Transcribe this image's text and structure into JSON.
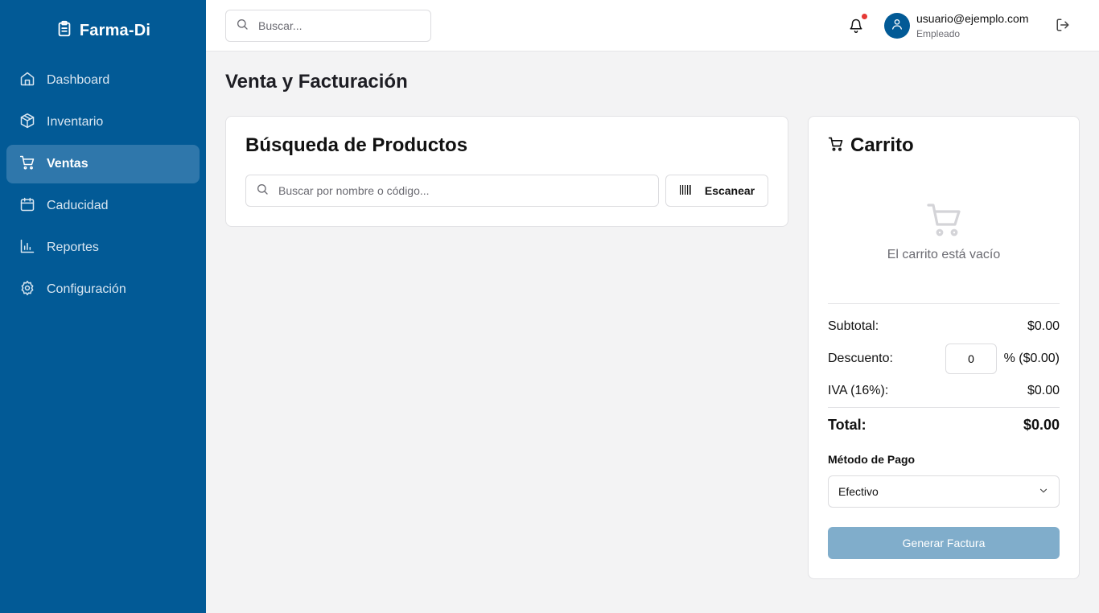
{
  "brand": {
    "name": "Farma-Di",
    "icon": "clipboard-icon"
  },
  "sidebar": {
    "items": [
      {
        "label": "Dashboard",
        "icon": "home-icon",
        "active": false
      },
      {
        "label": "Inventario",
        "icon": "package-icon",
        "active": false
      },
      {
        "label": "Ventas",
        "icon": "cart-icon",
        "active": true
      },
      {
        "label": "Caducidad",
        "icon": "calendar-icon",
        "active": false
      },
      {
        "label": "Reportes",
        "icon": "bar-chart-icon",
        "active": false
      },
      {
        "label": "Configuración",
        "icon": "settings-icon",
        "active": false
      }
    ]
  },
  "header": {
    "search_placeholder": "Buscar...",
    "user_email": "usuario@ejemplo.com",
    "user_role": "Empleado",
    "has_notification": true
  },
  "page": {
    "title": "Venta y Facturación"
  },
  "product_search": {
    "title": "Búsqueda de Productos",
    "placeholder": "Buscar por nombre o código...",
    "scan_label": "Escanear"
  },
  "cart": {
    "title": "Carrito",
    "empty_text": "El carrito está vacío",
    "subtotal_label": "Subtotal:",
    "subtotal_value": "$0.00",
    "discount_label": "Descuento:",
    "discount_input_value": "0",
    "discount_suffix": "% ($0.00)",
    "tax_label": "IVA (16%):",
    "tax_value": "$0.00",
    "total_label": "Total:",
    "total_value": "$0.00",
    "payment_label": "Método de Pago",
    "payment_selected": "Efectivo",
    "generate_label": "Generar Factura"
  },
  "colors": {
    "sidebar_bg": "#025a96",
    "active_item_bg": "#2f77ab",
    "button_disabled_bg": "#80adcb",
    "notification_dot": "#e53935"
  }
}
